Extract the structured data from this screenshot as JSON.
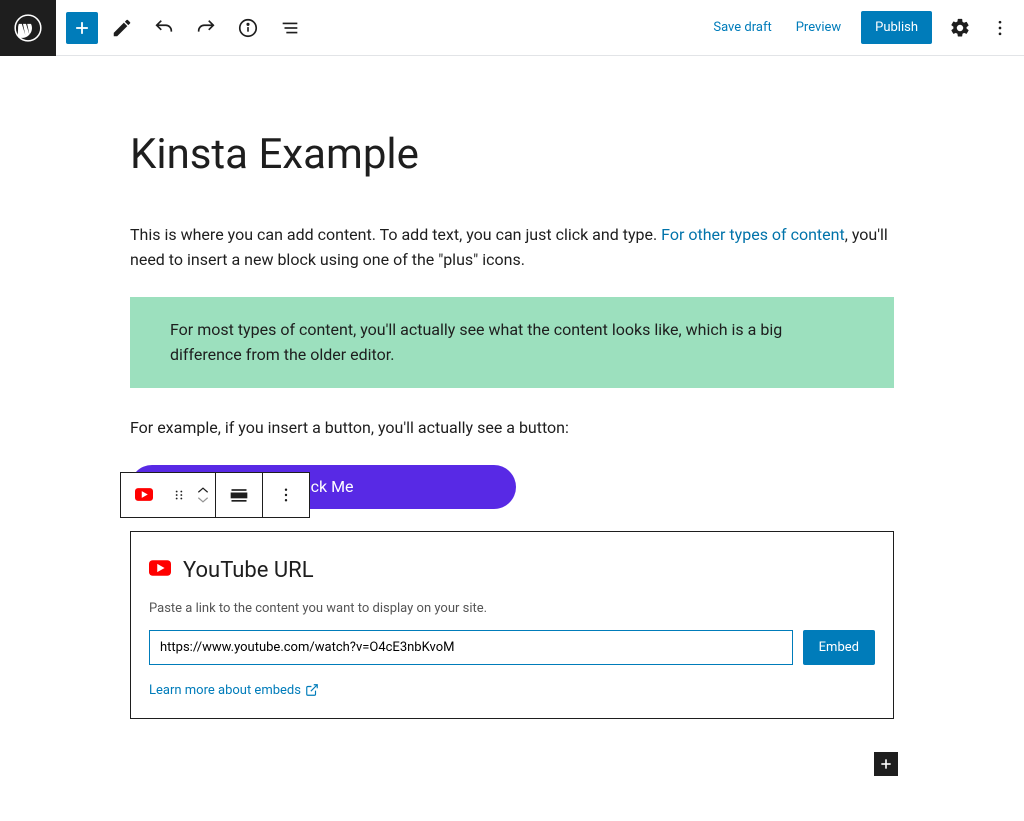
{
  "toolbar": {
    "save_draft": "Save draft",
    "preview": "Preview",
    "publish": "Publish"
  },
  "post": {
    "title": "Kinsta Example",
    "para1_a": "This is where you can add content. To add text, you can just click and type. ",
    "para1_link": "For other types of content",
    "para1_b": ", you'll need to insert a new block using one of the \"plus\" icons.",
    "callout": "For most types of content, you'll actually see what the content looks like, which is a big difference from the older editor.",
    "para2": "For example, if you insert a button, you'll actually see a button:",
    "button_label": "Click Me"
  },
  "embed": {
    "title": "YouTube URL",
    "instructions": "Paste a link to the content you want to display on your site.",
    "url_value": "https://www.youtube.com/watch?v=O4cE3nbKvoM",
    "embed_btn": "Embed",
    "learn_more": "Learn more about embeds"
  }
}
